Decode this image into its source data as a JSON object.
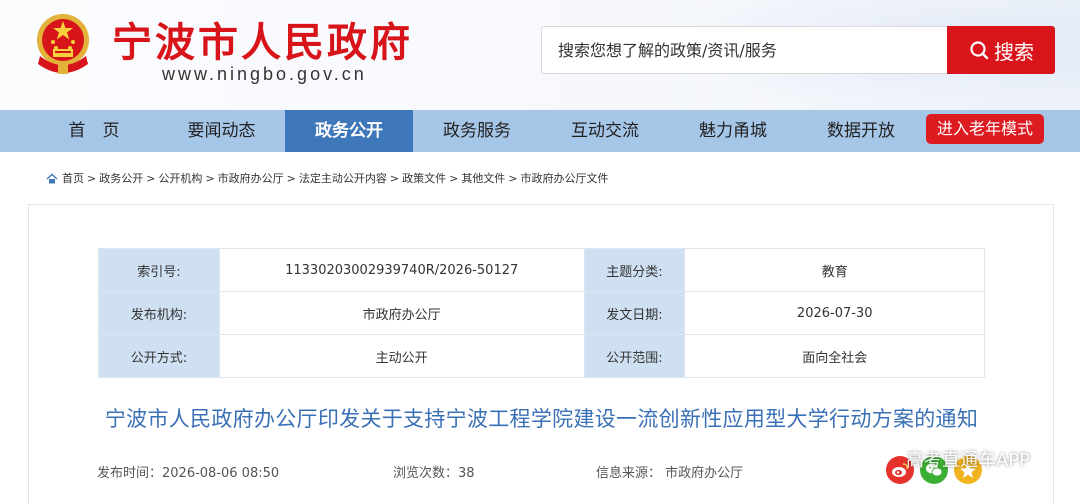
{
  "header": {
    "site_title": "宁波市人民政府",
    "site_url": "www.ningbo.gov.cn",
    "search_placeholder": "搜索您想了解的政策/资讯/服务",
    "search_button": "搜索"
  },
  "nav": {
    "items": [
      {
        "label": "首　页"
      },
      {
        "label": "要闻动态"
      },
      {
        "label": "政务公开"
      },
      {
        "label": "政务服务"
      },
      {
        "label": "互动交流"
      },
      {
        "label": "魅力甬城"
      },
      {
        "label": "数据开放"
      }
    ],
    "active": "政务公开",
    "elder_mode": "进入老年模式"
  },
  "breadcrumb": [
    "首页",
    "政务公开",
    "公开机构",
    "市政府办公厅",
    "法定主动公开内容",
    "政策文件",
    "其他文件",
    "市政府办公厅文件"
  ],
  "meta": {
    "index_label": "索引号:",
    "index_value": "11330203002939740R/2026-50127",
    "topic_label": "主题分类:",
    "topic_value": "教育",
    "publisher_label": "发布机构:",
    "publisher_value": "市政府办公厅",
    "date_label": "发文日期:",
    "date_value": "2026-07-30",
    "mode_label": "公开方式:",
    "mode_value": "主动公开",
    "scope_label": "公开范围:",
    "scope_value": "面向全社会"
  },
  "document": {
    "title": "宁波市人民政府办公厅印发关于支持宁波工程学院建设一流创新性应用型大学行动方案的通知",
    "publish_time": "发布时间：2026-08-06 08:50",
    "views": "浏览次数：38",
    "source": "信息来源：  市政府办公厅"
  },
  "share_icons": [
    "weibo-icon",
    "wechat-icon",
    "qzone-icon"
  ],
  "watermark": "高考直通车APP",
  "colors": {
    "brand_red": "#d9151b",
    "nav_bg": "#a6c6e8",
    "nav_active": "#3e78ba",
    "title_blue": "#3a70b5",
    "label_bg": "#cfe0f2"
  }
}
